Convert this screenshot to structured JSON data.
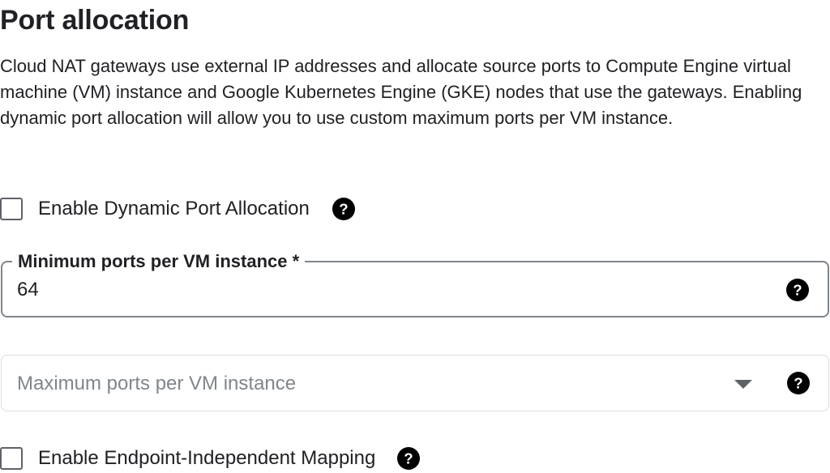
{
  "section": {
    "title": "Port allocation",
    "description": "Cloud NAT gateways use external IP addresses and allocate source ports to Compute Engine virtual machine (VM) instance and Google Kubernetes Engine (GKE) nodes that use the gateways. Enabling dynamic port allocation will allow you to use custom maximum ports per VM instance."
  },
  "dynamic_port_allocation": {
    "label": "Enable Dynamic Port Allocation",
    "checked": false,
    "help_icon": "help-circle-icon"
  },
  "min_ports_field": {
    "label": "Minimum ports per VM instance *",
    "value": "64",
    "help_icon": "help-circle-icon"
  },
  "max_ports_field": {
    "placeholder": "Maximum ports per VM instance",
    "disabled": true,
    "dropdown_icon": "arrow-drop-down-icon",
    "help_icon": "help-circle-icon"
  },
  "endpoint_independent_mapping": {
    "label": "Enable Endpoint-Independent Mapping",
    "checked": false,
    "help_icon": "help-circle-icon"
  },
  "colors": {
    "text": "#202124",
    "secondary_text": "#80868b",
    "border_active": "#80868b",
    "border_disabled": "#dadce0",
    "icon": "#000000"
  }
}
